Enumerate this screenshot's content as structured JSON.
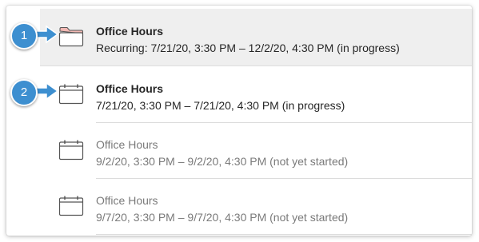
{
  "annotations": [
    {
      "label": "1"
    },
    {
      "label": "2"
    }
  ],
  "events": [
    {
      "title": "Office Hours",
      "details": "Recurring: 7/21/20, 3:30 PM – 12/2/20, 4:30 PM (in progress)",
      "icon": "folder-icon"
    },
    {
      "title": "Office Hours",
      "details": "7/21/20, 3:30 PM – 7/21/20, 4:30 PM (in progress)",
      "icon": "calendar-icon"
    },
    {
      "title": "Office Hours",
      "details": "9/2/20, 3:30 PM – 9/2/20, 4:30 PM (not yet started)",
      "icon": "calendar-icon"
    },
    {
      "title": "Office Hours",
      "details": "9/7/20, 3:30 PM – 9/7/20, 4:30 PM (not yet started)",
      "icon": "calendar-icon"
    }
  ],
  "colors": {
    "badge": "#3d8fd0",
    "folder_tab": "#f2b8b3",
    "selected_row": "#efefef"
  }
}
